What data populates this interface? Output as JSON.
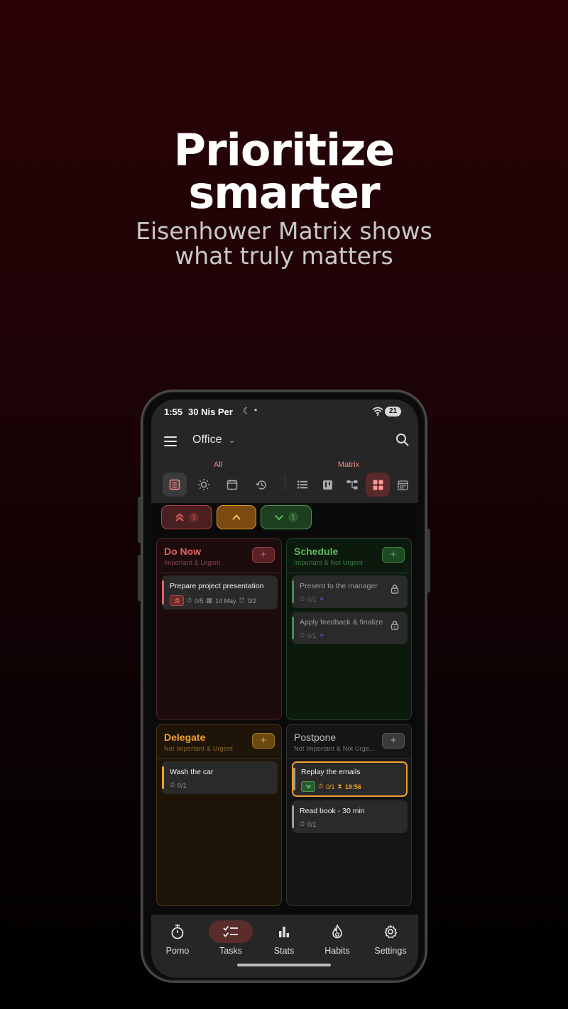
{
  "hero": {
    "title_line1": "Prioritize",
    "title_line2": "smarter",
    "subtitle_line1": "Eisenhower Matrix shows",
    "subtitle_line2": "what truly matters"
  },
  "status_bar": {
    "time": "1:55",
    "date": "30 Nis Per",
    "battery": "21"
  },
  "app_bar": {
    "list_name": "Office"
  },
  "view_groups": {
    "all_label": "All",
    "matrix_label": "Matrix"
  },
  "filters": [
    {
      "name": "urgent",
      "count": "1",
      "color": "#e06060"
    },
    {
      "name": "high",
      "count": "",
      "color": "#f0a030"
    },
    {
      "name": "low",
      "count": "1",
      "color": "#5cb85c"
    }
  ],
  "quadrants": {
    "do_now": {
      "title": "Do Now",
      "subtitle": "Important & Urgent",
      "add": "+",
      "tasks": [
        {
          "name": "Prepare project presentation",
          "pomo": "0/5",
          "date": "14 May",
          "subtasks": "0/2"
        }
      ]
    },
    "schedule": {
      "title": "Schedule",
      "subtitle": "Important & Not Urgent",
      "add": "+",
      "tasks": [
        {
          "name": "Present to the manager",
          "pomo": "0/1"
        },
        {
          "name": "Apply feedback & finalize",
          "pomo": "0/1"
        }
      ]
    },
    "delegate": {
      "title": "Delegate",
      "subtitle": "Not Important & Urgent",
      "add": "+",
      "tasks": [
        {
          "name": "Wash the car",
          "pomo": "0/1"
        }
      ]
    },
    "postpone": {
      "title": "Postpone",
      "subtitle": "Not Important & Not Urge...",
      "add": "+",
      "tasks": [
        {
          "name": "Replay the emails",
          "pomo": "0/1",
          "timer": "19:56"
        },
        {
          "name": "Read book - 30 min",
          "pomo": "0/1"
        }
      ]
    }
  },
  "nav": [
    {
      "label": "Pomo",
      "icon": "stopwatch-icon"
    },
    {
      "label": "Tasks",
      "icon": "checklist-icon"
    },
    {
      "label": "Stats",
      "icon": "bar-chart-icon"
    },
    {
      "label": "Habits",
      "icon": "flame-icon"
    },
    {
      "label": "Settings",
      "icon": "gear-icon"
    }
  ],
  "colors": {
    "accent": "#ff8a8a",
    "do_now": "#e06060",
    "schedule": "#5cb85c",
    "delegate": "#f0a030",
    "postpone": "#9e9e9e"
  }
}
